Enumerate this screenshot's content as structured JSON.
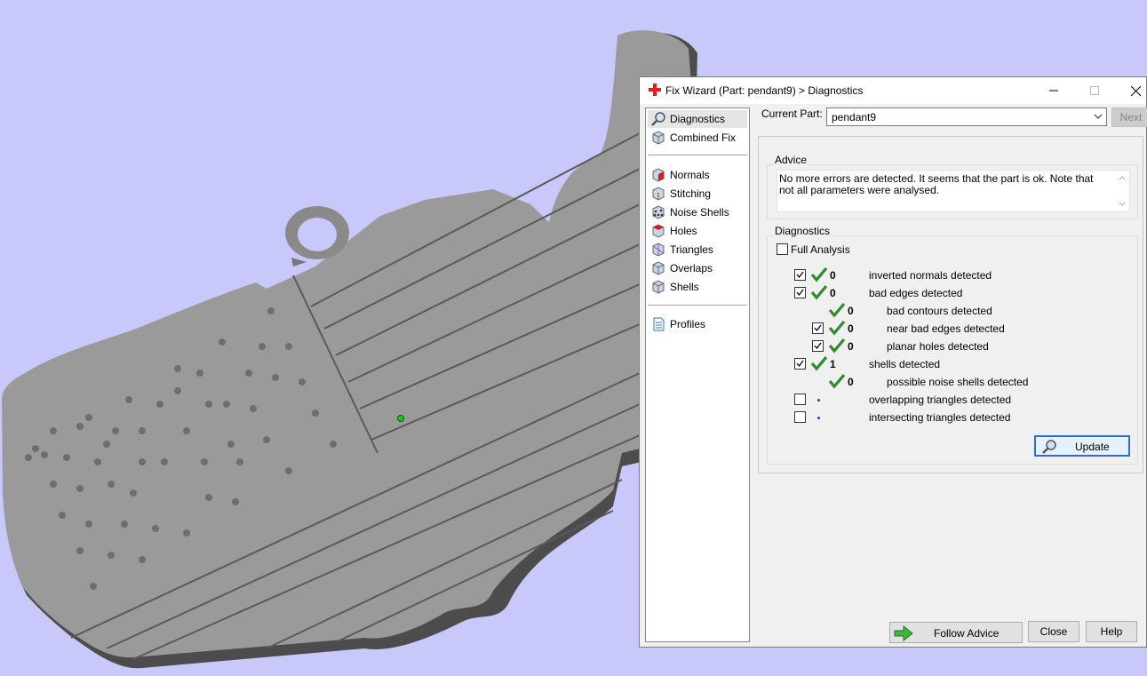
{
  "viewport": {
    "background": "#c8c8fa",
    "model_color": "#9a9a9a"
  },
  "window": {
    "title": "Fix Wizard (Part: pendant9) > Diagnostics",
    "icon": "red-cross-icon",
    "minimize": "minimize-icon",
    "maximize": "maximize-icon",
    "close": "close-icon"
  },
  "nav": {
    "items": [
      {
        "label": "Diagnostics",
        "icon": "magnifier-icon",
        "selected": true
      },
      {
        "label": "Combined Fix",
        "icon": "cube-icon"
      },
      {
        "label": "Normals",
        "icon": "normals-cube-icon"
      },
      {
        "label": "Stitching",
        "icon": "stitching-cube-icon"
      },
      {
        "label": "Noise Shells",
        "icon": "noise-shells-icon"
      },
      {
        "label": "Holes",
        "icon": "holes-cube-icon"
      },
      {
        "label": "Triangles",
        "icon": "triangles-cube-icon"
      },
      {
        "label": "Overlaps",
        "icon": "overlaps-cube-icon"
      },
      {
        "label": "Shells",
        "icon": "shells-cube-icon"
      },
      {
        "label": "Profiles",
        "icon": "document-icon"
      }
    ]
  },
  "current_part": {
    "label": "Current Part:",
    "value": "pendant9"
  },
  "next_label": "Next",
  "advice": {
    "title": "Advice",
    "text": "No more errors are detected. It seems that the part is ok. Note that not all parameters were analysed."
  },
  "diagnostics": {
    "title": "Diagnostics",
    "full_analysis": {
      "label": "Full Analysis",
      "checked": false
    },
    "rows": [
      {
        "checkbox": true,
        "checked": true,
        "status": "ok",
        "count": "0",
        "label": "inverted normals detected"
      },
      {
        "checkbox": true,
        "checked": true,
        "status": "ok",
        "count": "0",
        "label": "bad edges detected"
      },
      {
        "checkbox": false,
        "status": "ok",
        "count": "0",
        "label": "bad contours detected"
      },
      {
        "checkbox": true,
        "checked": true,
        "status": "ok",
        "count": "0",
        "label": "near bad edges detected"
      },
      {
        "checkbox": true,
        "checked": true,
        "status": "ok",
        "count": "0",
        "label": "planar holes detected"
      },
      {
        "checkbox": true,
        "checked": true,
        "status": "ok",
        "count": "1",
        "label": "shells detected"
      },
      {
        "checkbox": false,
        "status": "ok",
        "count": "0",
        "label": "possible noise shells detected"
      },
      {
        "checkbox": true,
        "checked": false,
        "status": "pending",
        "count": "",
        "label": "overlapping triangles detected"
      },
      {
        "checkbox": true,
        "checked": false,
        "status": "pending",
        "count": "",
        "label": "intersecting triangles detected"
      }
    ],
    "update_label": "Update"
  },
  "footer": {
    "follow_advice": "Follow Advice",
    "close": "Close",
    "help": "Help"
  }
}
